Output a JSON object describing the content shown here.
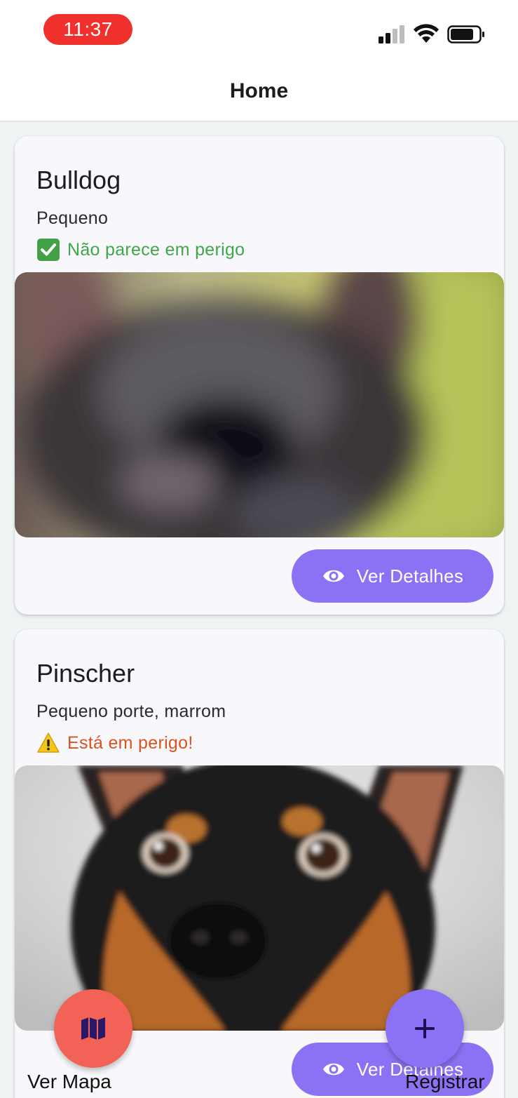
{
  "status_bar": {
    "time": "11:37"
  },
  "app_bar": {
    "title": "Home"
  },
  "cards": [
    {
      "name": "Bulldog",
      "description": "Pequeno",
      "status_text": "Não parece em perigo",
      "status_icon": "check-box-icon",
      "status_color": "#3fa64a",
      "details_label": "Ver Detalhes"
    },
    {
      "name": "Pinscher",
      "description": "Pequeno porte, marrom",
      "status_text": "Está em perigo!",
      "status_icon": "warning-icon",
      "status_color": "#d9531e",
      "details_label": "Ver Detalhes"
    }
  ],
  "fabs": {
    "map_label": "Ver Mapa",
    "map_icon": "map-icon",
    "add_label": "Registrar",
    "add_icon": "plus-icon"
  },
  "colors": {
    "accent": "#8b72f5",
    "map_button": "#f26257",
    "time_pill": "#f0302c"
  }
}
